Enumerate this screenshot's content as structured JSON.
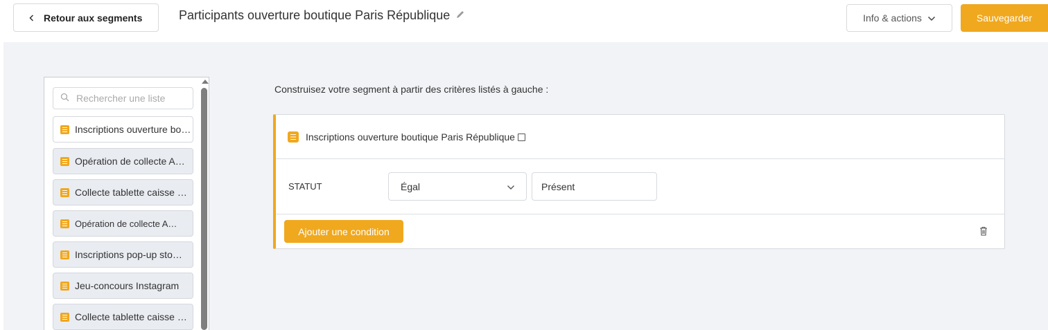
{
  "header": {
    "back_label": "Retour aux segments",
    "title": "Participants ouverture boutique Paris République",
    "info_label": "Info & actions",
    "save_label": "Sauvegarder"
  },
  "sidebar": {
    "search_placeholder": "Rechercher une liste",
    "items": [
      {
        "label": "Inscriptions ouverture boutique Paris République",
        "active": true
      },
      {
        "label": "Opération de collecte A…",
        "active": false
      },
      {
        "label": "Collecte tablette caisse …",
        "active": false
      },
      {
        "label": "Opération de collecte A…",
        "active": false
      },
      {
        "label": "Inscriptions pop-up sto…",
        "active": false
      },
      {
        "label": "Jeu-concours Instagram",
        "active": false
      },
      {
        "label": "Collecte tablette caisse …",
        "active": false
      }
    ]
  },
  "main": {
    "instruction": "Construisez votre segment à partir des critères listés à gauche :",
    "segment": {
      "list_name": "Inscriptions ouverture boutique Paris République",
      "condition": {
        "field": "STATUT",
        "operator": "Égal",
        "value": "Présent"
      },
      "add_condition_label": "Ajouter une condition"
    }
  },
  "colors": {
    "accent": "#f0a81e",
    "workspace_bg": "#f1f3f6"
  }
}
